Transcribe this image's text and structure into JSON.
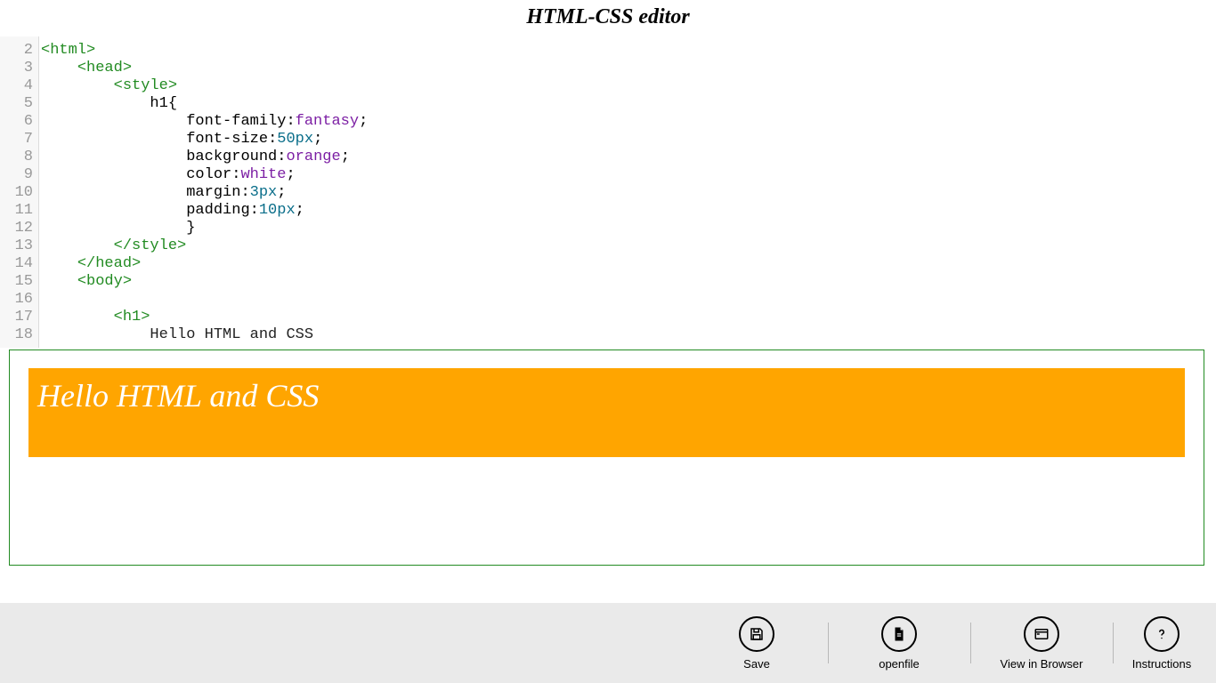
{
  "title": "HTML-CSS editor",
  "gutter_start": 2,
  "gutter_end": 18,
  "code_lines": [
    {
      "indent": 0,
      "t": "tag",
      "tx": "<html>"
    },
    {
      "indent": 1,
      "t": "tag",
      "tx": "<head>"
    },
    {
      "indent": 2,
      "t": "tag",
      "tx": "<style>"
    },
    {
      "indent": 3,
      "t": "sel",
      "tx": "h1{"
    },
    {
      "indent": 4,
      "t": "decl",
      "prop": "font-family",
      "val": "fantasy",
      "vt": "ident"
    },
    {
      "indent": 4,
      "t": "decl",
      "prop": "font-size",
      "val": "50px",
      "vt": "num"
    },
    {
      "indent": 4,
      "t": "decl",
      "prop": "background",
      "val": "orange",
      "vt": "ident"
    },
    {
      "indent": 4,
      "t": "decl",
      "prop": "color",
      "val": "white",
      "vt": "ident"
    },
    {
      "indent": 4,
      "t": "decl",
      "prop": "margin",
      "val": "3px",
      "vt": "num"
    },
    {
      "indent": 4,
      "t": "decl",
      "prop": "padding",
      "val": "10px",
      "vt": "num"
    },
    {
      "indent": 4,
      "t": "sel",
      "tx": "}"
    },
    {
      "indent": 2,
      "t": "tag",
      "tx": "</style>"
    },
    {
      "indent": 1,
      "t": "tag",
      "tx": "</head>"
    },
    {
      "indent": 1,
      "t": "tag",
      "tx": "<body>"
    },
    {
      "indent": 0,
      "t": "blank",
      "tx": ""
    },
    {
      "indent": 2,
      "t": "tag",
      "tx": "<h1>"
    },
    {
      "indent": 3,
      "t": "text",
      "tx": "Hello HTML and CSS"
    }
  ],
  "preview": {
    "h1": "Hello HTML and CSS"
  },
  "toolbar": {
    "save": "Save",
    "open": "openfile",
    "view": "View in Browser",
    "instr": "Instructions"
  }
}
